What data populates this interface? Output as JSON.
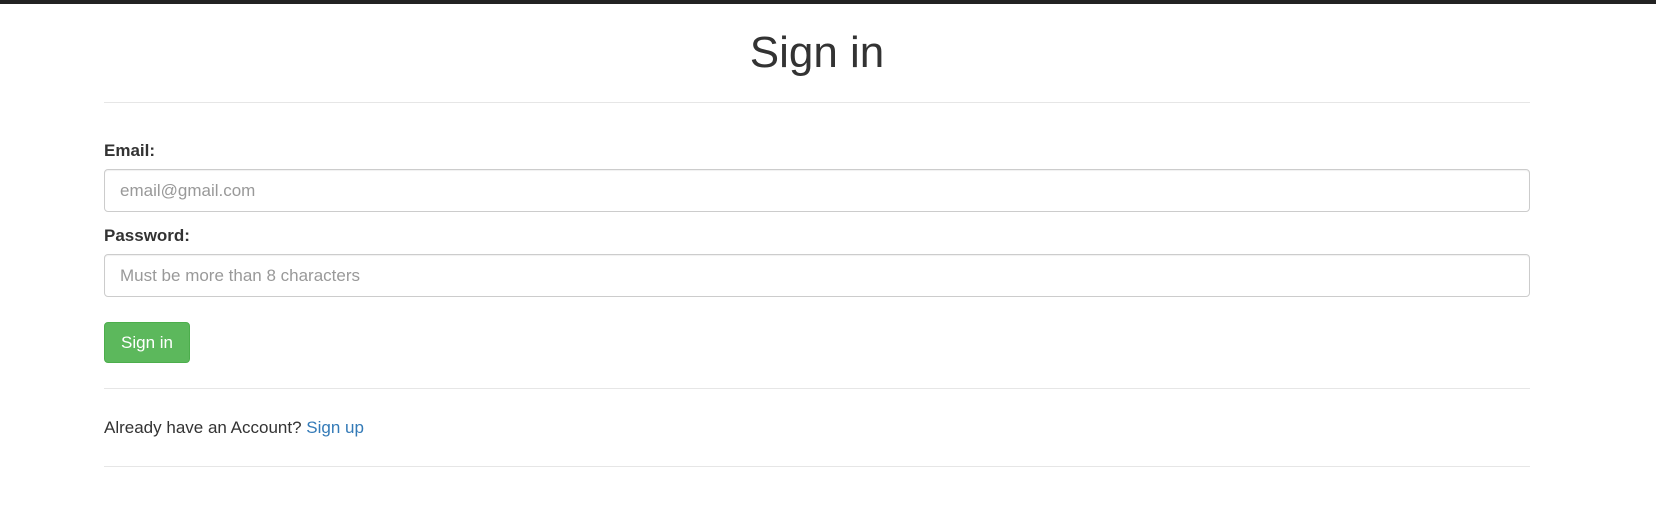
{
  "page": {
    "title": "Sign in"
  },
  "form": {
    "email_label": "Email:",
    "email_placeholder": "email@gmail.com",
    "email_value": "",
    "password_label": "Password:",
    "password_placeholder": "Must be more than 8 characters",
    "password_value": "",
    "submit_label": "Sign in"
  },
  "footer": {
    "prompt": "Already have an Account?",
    "link_label": "Sign up"
  },
  "colors": {
    "primary_button": "#5cb85c",
    "link": "#337ab7",
    "top_bar": "#222222"
  }
}
